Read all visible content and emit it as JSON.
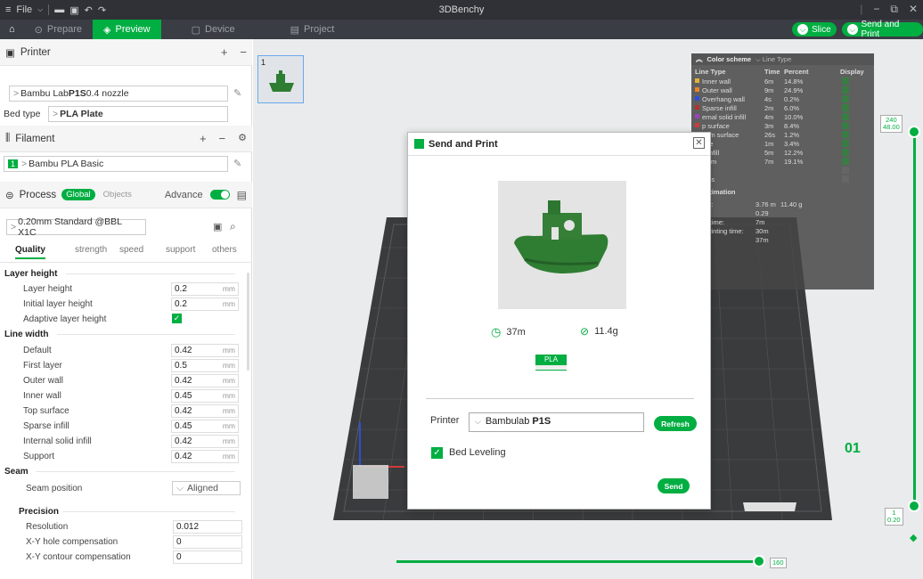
{
  "titlebar": {
    "file_label": "File",
    "app_title": "3DBenchy"
  },
  "tabs": [
    {
      "label": "Prepare"
    },
    {
      "label": "Preview"
    },
    {
      "label": "Device"
    },
    {
      "label": "Project"
    }
  ],
  "toolbar": {
    "slice_label": "Slice",
    "send_print_label": "Send and Print"
  },
  "printer": {
    "section_title": "Printer",
    "name_prefix": "Bambu Lab ",
    "name_bold": "P1S",
    "name_suffix": " 0.4 nozzle",
    "bed_type_label": "Bed type",
    "bed_type_value": "PLA Plate"
  },
  "filament": {
    "section_title": "Filament",
    "slot": "1",
    "name": "Bambu PLA Basic"
  },
  "process": {
    "section_title": "Process",
    "global_label": "Global",
    "objects_label": "Objects",
    "advance_label": "Advance",
    "preset": "0.20mm Standard @BBL X1C",
    "tabs": [
      "Quality",
      "strength",
      "speed",
      "support",
      "others"
    ]
  },
  "settings": {
    "layer_height_header": "Layer height",
    "layer_height": {
      "label": "Layer height",
      "value": "0.2",
      "unit": "mm"
    },
    "initial_layer_height": {
      "label": "Initial layer height",
      "value": "0.2",
      "unit": "mm"
    },
    "adaptive_layer_height": {
      "label": "Adaptive layer height"
    },
    "line_width_header": "Line width",
    "default": {
      "label": "Default",
      "value": "0.42",
      "unit": "mm"
    },
    "first_layer": {
      "label": "First layer",
      "value": "0.5",
      "unit": "mm"
    },
    "outer_wall": {
      "label": "Outer wall",
      "value": "0.42",
      "unit": "mm"
    },
    "inner_wall": {
      "label": "Inner wall",
      "value": "0.45",
      "unit": "mm"
    },
    "top_surface": {
      "label": "Top surface",
      "value": "0.42",
      "unit": "mm"
    },
    "sparse_infill": {
      "label": "Sparse infill",
      "value": "0.45",
      "unit": "mm"
    },
    "internal_solid_infill": {
      "label": "Internal solid infill",
      "value": "0.42",
      "unit": "mm"
    },
    "support": {
      "label": "Support",
      "value": "0.42",
      "unit": "mm"
    },
    "seam_header": "Seam",
    "seam_position": {
      "label": "Seam position",
      "value": "Aligned"
    },
    "precision_header": "Precision",
    "resolution": {
      "label": "Resolution",
      "value": "0.012"
    },
    "xy_hole": {
      "label": "X-Y hole compensation",
      "value": "0"
    },
    "xy_contour": {
      "label": "X-Y contour compensation",
      "value": "0"
    }
  },
  "canvas": {
    "plate_index": "1",
    "plate_label": "01",
    "top_layer_count": "240",
    "top_layer_height": "48.00",
    "bottom_layer_count": "1",
    "bottom_layer_height": "0.20",
    "h_slider_value": "160"
  },
  "color_scheme": {
    "title": "Color scheme",
    "mode": "Line Type",
    "col_type": "Line Type",
    "col_time": "Time",
    "col_percent": "Percent",
    "col_display": "Display",
    "rows": [
      {
        "name": "Inner wall",
        "time": "6m",
        "percent": "14.8%",
        "color": "#e3b03a"
      },
      {
        "name": "Outer wall",
        "time": "9m",
        "percent": "24.9%",
        "color": "#e8832a"
      },
      {
        "name": "Overhang wall",
        "time": "4s",
        "percent": "0.2%",
        "color": "#2b4fd6"
      },
      {
        "name": "Sparse infill",
        "time": "2m",
        "percent": "6.0%",
        "color": "#b0322a"
      },
      {
        "name": "ernal solid infill",
        "time": "4m",
        "percent": "10.0%",
        "color": "#9d3fbf"
      },
      {
        "name": "p surface",
        "time": "3m",
        "percent": "8.4%",
        "color": "#d03a3a"
      },
      {
        "name": "ttom surface",
        "time": "26s",
        "percent": "1.2%",
        "color": "#6d7d3a"
      },
      {
        "name": "dge",
        "time": "1m",
        "percent": "3.4%",
        "color": "#2aa8a0"
      },
      {
        "name": "p infill",
        "time": "5m",
        "percent": "12.2%",
        "color": "#7ad05a"
      },
      {
        "name": "stom",
        "time": "7m",
        "percent": "19.1%",
        "color": "#6a9ad8"
      },
      {
        "name": "vel",
        "time": "",
        "percent": "",
        "color": "#888888"
      },
      {
        "name": "ams",
        "time": "",
        "percent": "",
        "color": "#888888"
      }
    ],
    "estimation_title": "estimation",
    "est_rows": [
      {
        "label": "ent:",
        "v1": "3.76 m",
        "v2": "11.40 g"
      },
      {
        "label": "",
        "v1": "0.29",
        "v2": ""
      },
      {
        "label": "re time:",
        "v1": "7m",
        "v2": ""
      },
      {
        "label": "l printing time:",
        "v1": "30m",
        "v2": ""
      },
      {
        "label": "",
        "v1": "37m",
        "v2": ""
      }
    ]
  },
  "dialog": {
    "title": "Send and Print",
    "time": "37m",
    "weight": "11.4g",
    "filament_tag": "PLA",
    "printer_label": "Printer",
    "printer_prefix": "Bambulab ",
    "printer_bold": "P1S",
    "refresh_label": "Refresh",
    "bed_leveling_label": "Bed Leveling",
    "send_label": "Send"
  },
  "colors": {
    "accent": "#00ae42",
    "titlebar": "#2f3136",
    "tabbar": "#3a3d43"
  }
}
